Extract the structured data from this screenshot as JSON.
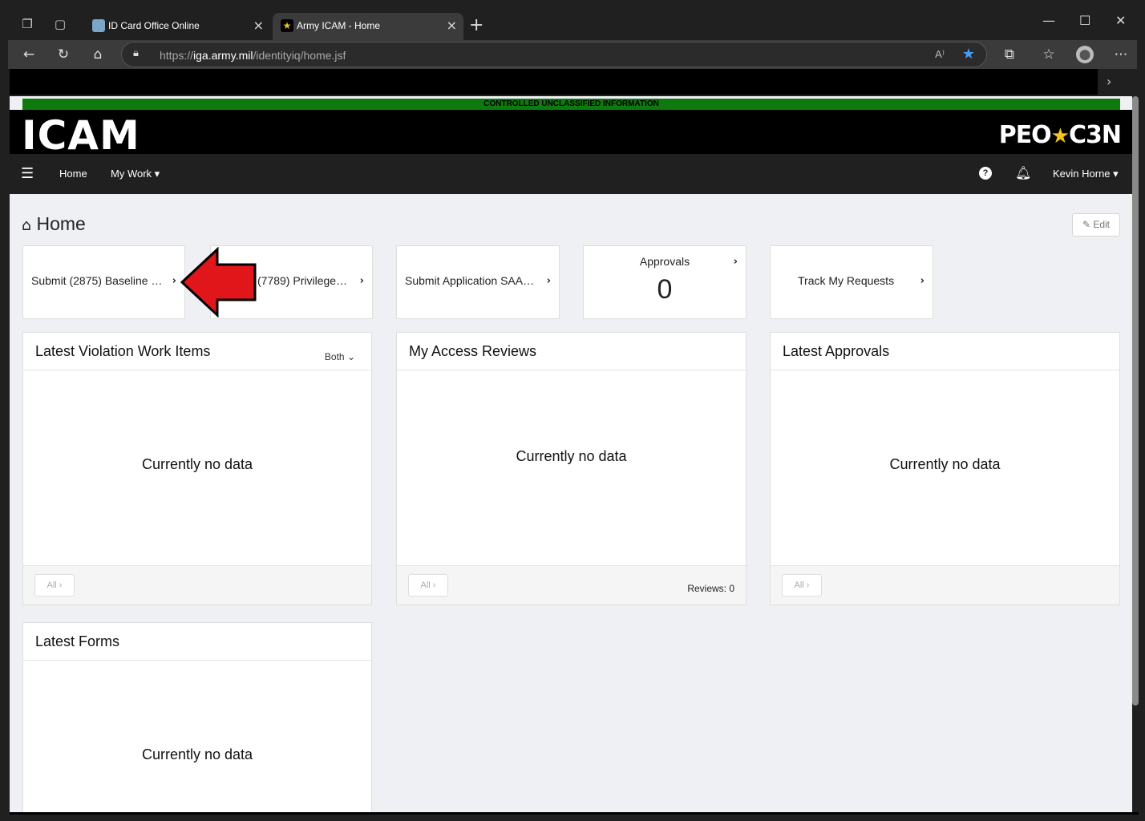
{
  "browser": {
    "tabs": [
      {
        "title": "ID Card Office Online",
        "active": false
      },
      {
        "title": "Army ICAM - Home",
        "active": true
      }
    ],
    "url_prefix": "https://",
    "url_host": "iga.army.mil",
    "url_path": "/identityiq/home.jsf",
    "read_aloud": "A⁾",
    "new_tab": "+",
    "window_controls": {
      "minimize": "—",
      "maximize": "☐",
      "close": "✕"
    }
  },
  "banner": {
    "classification": "CONTROLLED UNCLASSIFIED INFORMATION",
    "classification_color": "#0e7a0e"
  },
  "header": {
    "logo_left": "ICAM",
    "logo_right_a": "PEO",
    "logo_right_star": "★",
    "logo_right_b": "C3N"
  },
  "menu": {
    "home": "Home",
    "my_work": "My Work ▾",
    "user": "Kevin Horne ▾",
    "help": "?"
  },
  "page": {
    "title": "Home",
    "edit_label": "✎ Edit"
  },
  "quicklinks": [
    {
      "label": "Submit (2875) Baseline …",
      "arrow": "›"
    },
    {
      "label": "(7789) Privilege…",
      "arrow": "›"
    },
    {
      "label": "Submit Application SAA…",
      "arrow": "›"
    },
    {
      "title": "Approvals",
      "count": "0",
      "arrow": "›"
    },
    {
      "label": "Track My Requests",
      "arrow": "›"
    }
  ],
  "panels": {
    "violations": {
      "title": "Latest Violation Work Items",
      "filter": "Both ⌄",
      "empty": "Currently no data",
      "all_label": "All ›"
    },
    "reviews": {
      "title": "My Access Reviews",
      "empty": "Currently no data",
      "all_label": "All ›",
      "reviews_count": "Reviews: 0"
    },
    "approvals": {
      "title": "Latest Approvals",
      "empty": "Currently no data",
      "all_label": "All ›"
    },
    "forms": {
      "title": "Latest Forms",
      "empty": "Currently no data"
    }
  },
  "annotation": {
    "arrow_color": "#e0161b"
  }
}
